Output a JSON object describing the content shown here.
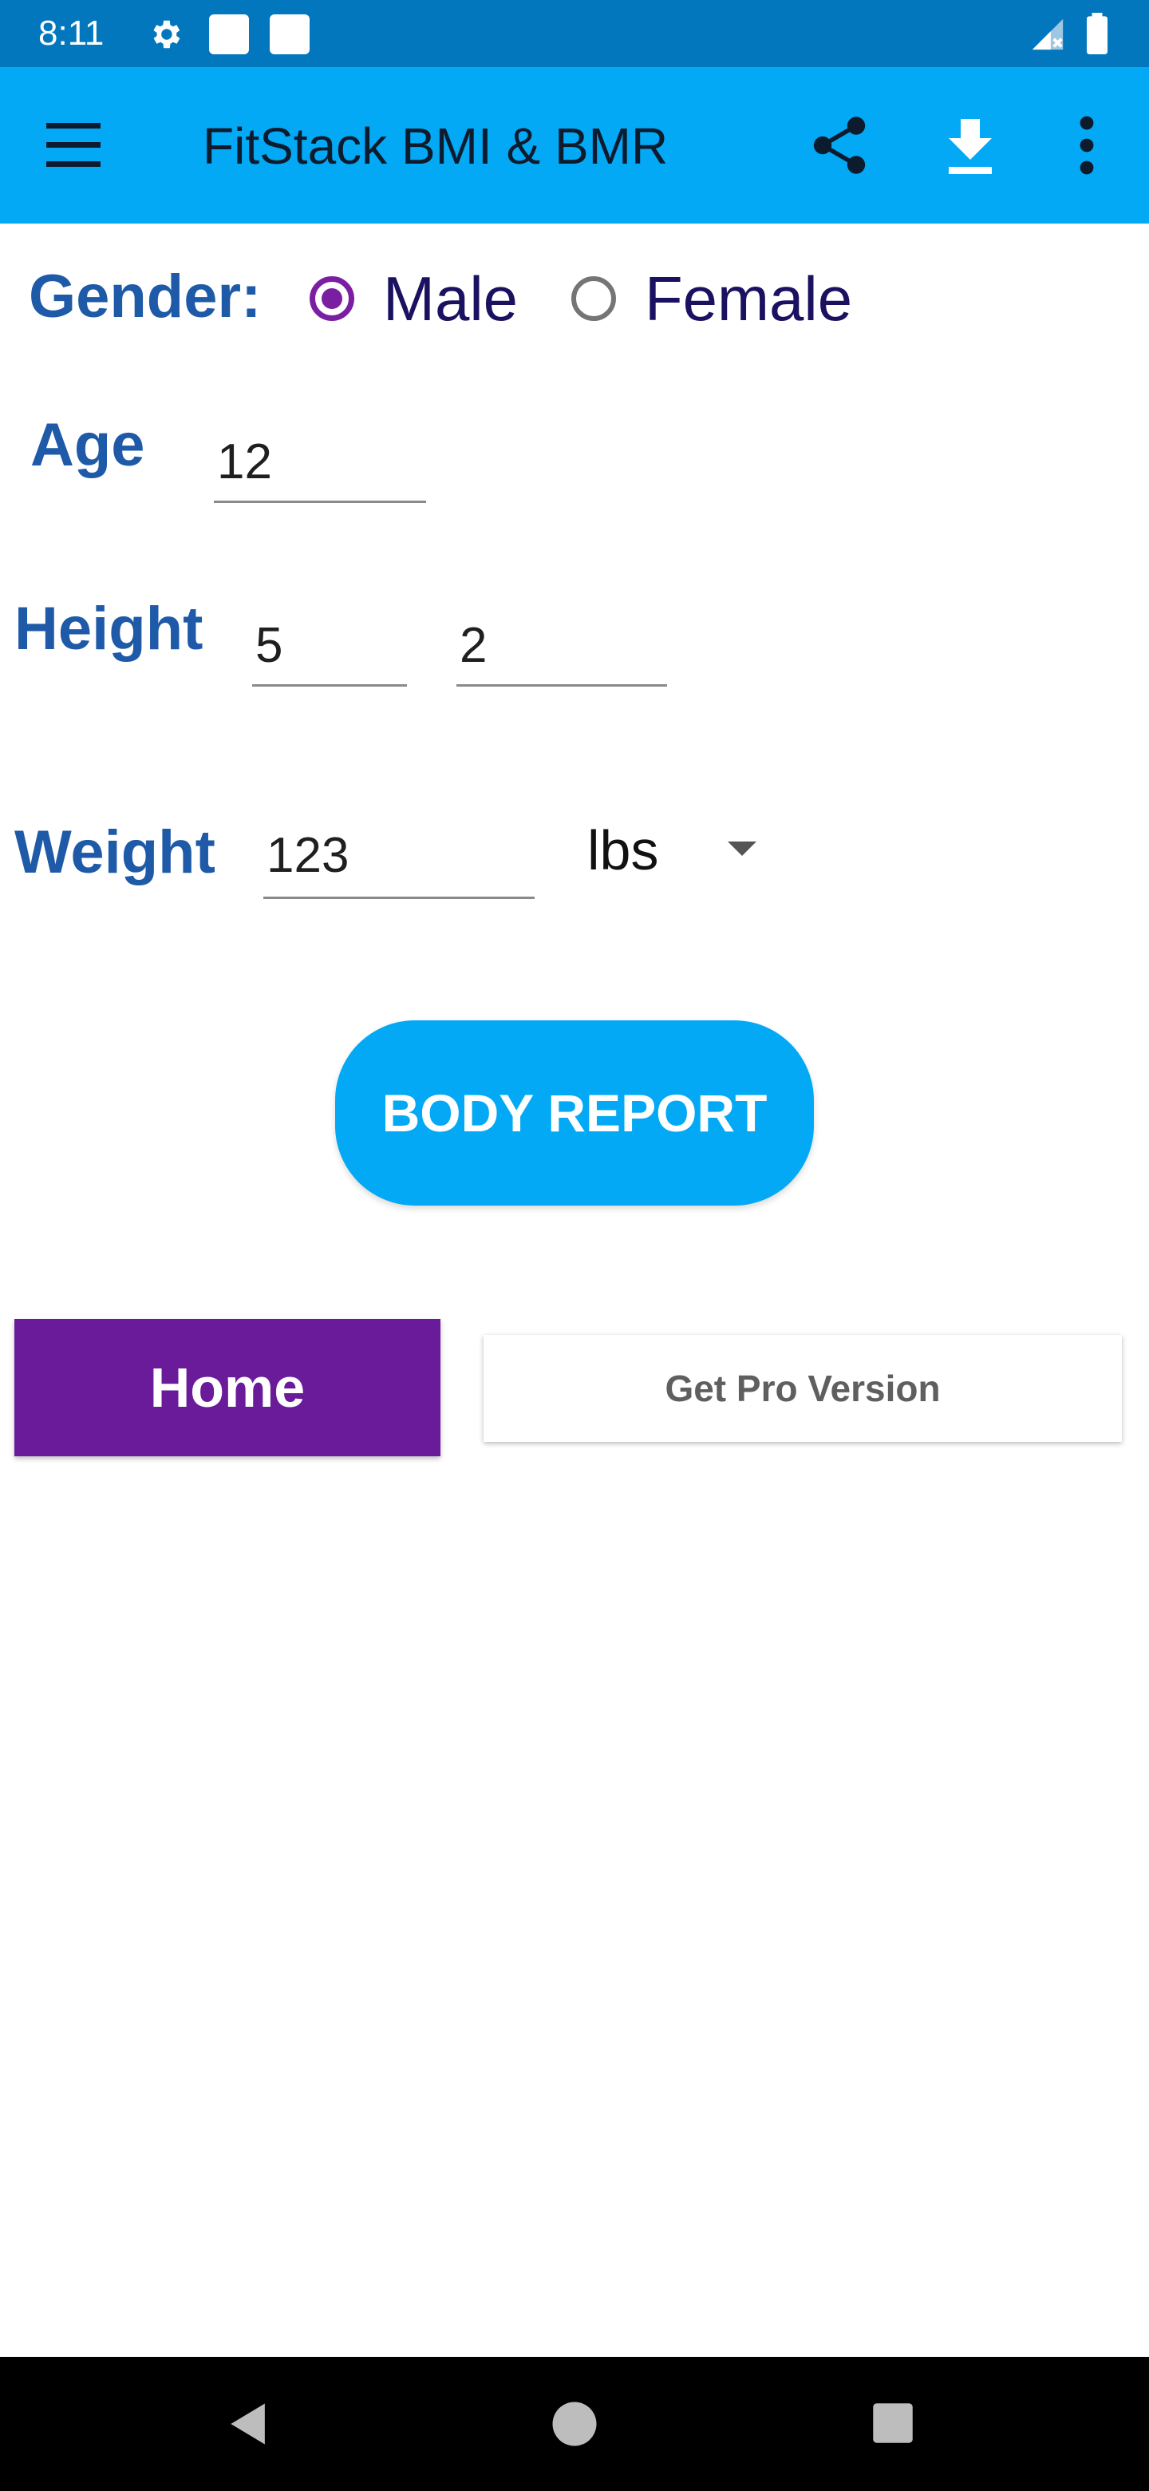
{
  "status_bar": {
    "time": "8:11",
    "icons": [
      "gear-icon",
      "notification-square-icon",
      "notification-square-icon",
      "signal-icon",
      "battery-icon"
    ]
  },
  "app_bar": {
    "title": "FitStack BMI & BMR",
    "icons": [
      "menu-icon",
      "share-icon",
      "download-icon",
      "more-vert-icon"
    ]
  },
  "form": {
    "gender_label": "Gender:",
    "gender_options": [
      {
        "label": "Male",
        "selected": true
      },
      {
        "label": "Female",
        "selected": false
      }
    ],
    "age_label": "Age",
    "age_value": "12",
    "height_label": "Height",
    "height_feet": "5",
    "height_inches": "2",
    "weight_label": "Weight",
    "weight_value": "123",
    "weight_unit": "lbs"
  },
  "buttons": {
    "body_report": "BODY REPORT",
    "home": "Home",
    "get_pro": "Get Pro Version"
  },
  "nav_bar": {
    "icons": [
      "back-icon",
      "home-circle-icon",
      "recents-icon"
    ]
  },
  "colors": {
    "status_bar": "#0277bd",
    "app_bar": "#03a9f4",
    "label": "#1e5aa8",
    "radio_selected": "#7b1fa2",
    "home_button": "#6a1b9a",
    "report_button": "#03a9f4"
  }
}
